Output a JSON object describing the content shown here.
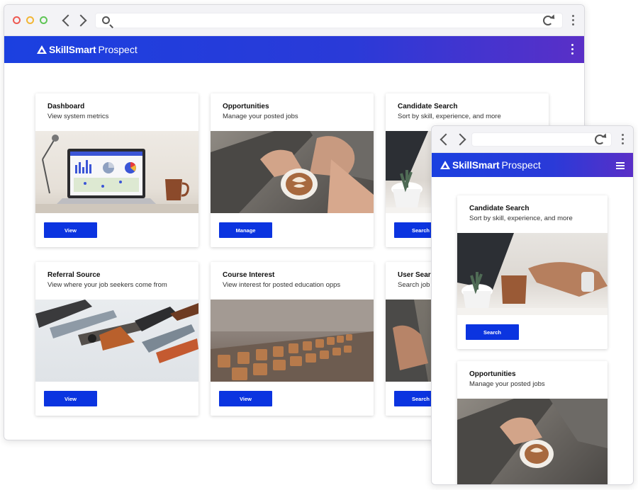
{
  "brand": {
    "name_bold": "SkillSmart",
    "name_light": "Prospect"
  },
  "colors": {
    "header_start": "#1b40e0",
    "header_end": "#5a2fc7",
    "button": "#0b34e0"
  },
  "desktop": {
    "cards": [
      {
        "title": "Dashboard",
        "subtitle": "View system metrics",
        "button": "View",
        "image": "laptop-dashboard-photo"
      },
      {
        "title": "Opportunities",
        "subtitle": "Manage your posted jobs",
        "button": "Manage",
        "image": "barista-latte-photo"
      },
      {
        "title": "Candidate Search",
        "subtitle": "Sort by skill, experience, and more",
        "button": "Search",
        "image": "laptop-coffee-photo"
      },
      {
        "title": "Referral Source",
        "subtitle": "View where your job seekers come from",
        "button": "View",
        "image": "tools-photo"
      },
      {
        "title": "Course Interest",
        "subtitle": "View interest for posted education opps",
        "button": "View",
        "image": "classroom-chairs-photo"
      },
      {
        "title": "User Searc",
        "subtitle": "Search job",
        "button": "Search",
        "image": "person-photo"
      }
    ]
  },
  "mobile": {
    "cards": [
      {
        "title": "Candidate Search",
        "subtitle": "Sort by skill, experience, and more",
        "button": "Search",
        "image": "laptop-coffee-photo"
      },
      {
        "title": "Opportunities",
        "subtitle": "Manage your posted jobs",
        "image": "barista-latte-photo"
      }
    ]
  }
}
